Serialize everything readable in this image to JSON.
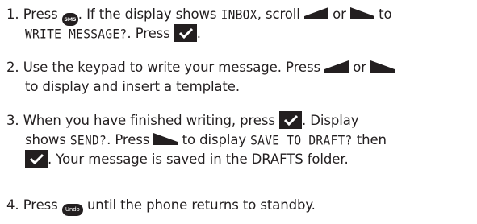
{
  "steps": [
    {
      "number": "1.",
      "line1": {
        "t1": "Press",
        "t2": ". If the display shows",
        "lcd1": "INBOX",
        "t3": ", scroll",
        "t4": "or",
        "t5": "to"
      },
      "line2": {
        "lcd2": "WRITE MESSAGE?",
        "t6": ". Press",
        "t7": "."
      }
    },
    {
      "number": "2.",
      "line1": {
        "t1": "Use the keypad to write your message. Press",
        "t2": "or"
      },
      "line2": {
        "t3": "to display and insert a template."
      }
    },
    {
      "number": "3.",
      "line1": {
        "t1": "When you have finished writing, press",
        "t2": ". Display"
      },
      "line2": {
        "t3": "shows",
        "lcd1": "SEND?",
        "t4": ". Press",
        "t5": "to display",
        "lcd2": "SAVE TO DRAFT?",
        "t6": "then"
      },
      "line3": {
        "t7": ". Your message is saved in the DRAFTS folder."
      }
    },
    {
      "number": "4.",
      "line1": {
        "t1": "Press",
        "t2": "until the phone returns to standby."
      }
    }
  ],
  "keys": {
    "sms": "SMS",
    "undo": "Undo"
  },
  "icons": {
    "sms": "sms-key-icon",
    "undo": "undo-key-icon",
    "left": "scroll-left-key-icon",
    "right": "scroll-right-key-icon",
    "check": "ok-checkmark-key-icon"
  },
  "colors": {
    "text": "#231f20",
    "key": "#231f20",
    "background": "#ffffff"
  }
}
